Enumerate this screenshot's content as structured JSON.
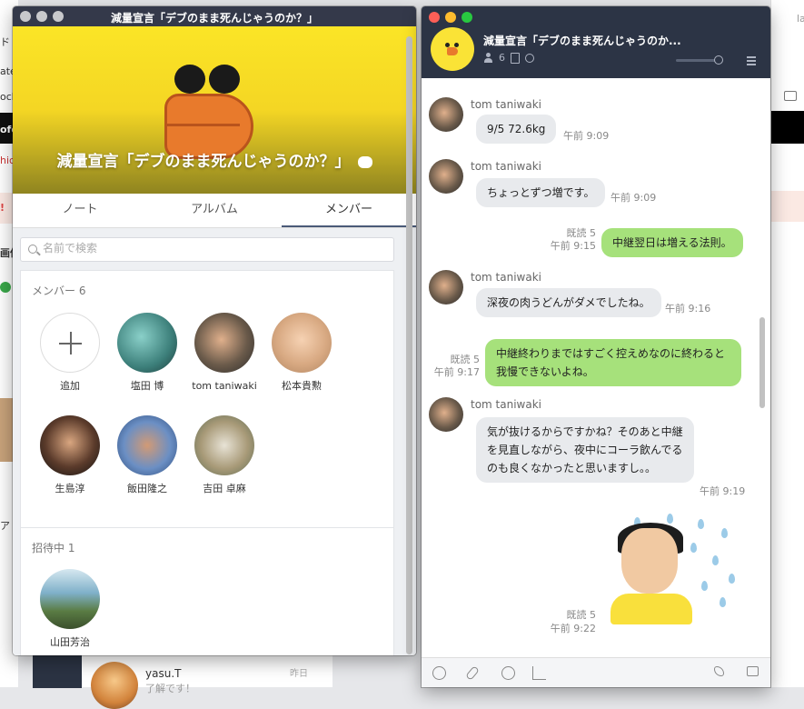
{
  "background": {
    "left_fragments": [
      "ド",
      "ate",
      "ock",
      "ofo",
      "hic",
      "!",
      "画像",
      "ア"
    ],
    "right_fragment": "la's",
    "bottom_chat": {
      "name": "yasu.T",
      "preview": "了解です！",
      "time": "昨日"
    }
  },
  "group_window": {
    "title": "減量宣言「デブのまま死んじゃうのか？」",
    "cover_title": "減量宣言「デブのまま死んじゃうのか？」",
    "tabs": [
      {
        "label": "ノート",
        "active": false
      },
      {
        "label": "アルバム",
        "active": false
      },
      {
        "label": "メンバー",
        "active": true
      }
    ],
    "search": {
      "placeholder": "名前で検索",
      "value": ""
    },
    "members_header": "メンバー 6",
    "add_label": "追加",
    "members": [
      {
        "name": "塩田 博"
      },
      {
        "name": "tom taniwaki"
      },
      {
        "name": "松本貴勲"
      },
      {
        "name": "生島淳"
      },
      {
        "name": "飯田隆之"
      },
      {
        "name": "吉田 卓麻"
      }
    ],
    "invited_header": "招待中 1",
    "invited": [
      {
        "name": "山田芳治"
      }
    ]
  },
  "chat_window": {
    "title": "減量宣言「デブのまま死んじゃうのか...",
    "member_count": "6",
    "messages": [
      {
        "sender": "tom taniwaki",
        "text": "9/5 72.6kg",
        "time": "午前 9:09",
        "own": false
      },
      {
        "sender": "tom taniwaki",
        "text": "ちょっとずつ増です。",
        "time": "午前 9:09",
        "own": false
      },
      {
        "sender": "",
        "text": "中継翌日は増える法則。",
        "time": "午前 9:15",
        "read": "既読 5",
        "own": true
      },
      {
        "sender": "tom taniwaki",
        "text": "深夜の肉うどんがダメでしたね。",
        "time": "午前 9:16",
        "own": false
      },
      {
        "sender": "",
        "text": "中継終わりまではすごく控えめなのに終わると我慢できないよね。",
        "time": "午前 9:17",
        "read": "既読 5",
        "own": true
      },
      {
        "sender": "tom taniwaki",
        "text": "気が抜けるからですかね？そのあと中継を見直しながら、夜中にコーラ飲んでるのも良くなかったと思いますし。。",
        "time": "午前 9:19",
        "own": false
      }
    ],
    "sticker_meta": {
      "read": "既読 5",
      "time": "午前 9:22"
    },
    "colors": {
      "header": "#2c3445",
      "own_bubble": "#a6e17b",
      "other_bubble": "#e8eaed"
    }
  }
}
